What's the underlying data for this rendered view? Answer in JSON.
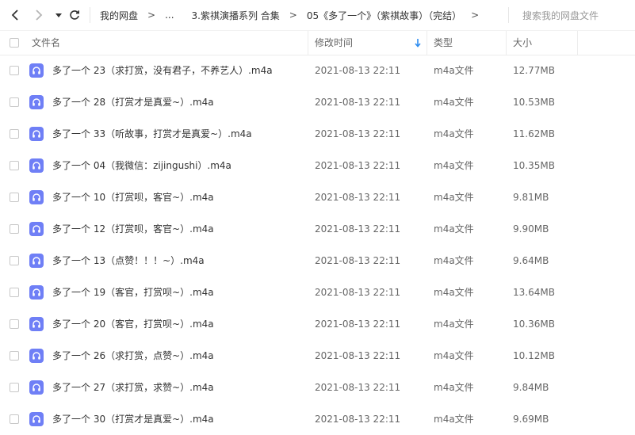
{
  "nav": {
    "breadcrumbs": [
      "我的网盘",
      "...",
      "3.紫祺演播系列 合集",
      "05《多了一个》（紫祺故事）（完结）"
    ],
    "separator": ">",
    "search_placeholder": "搜索我的网盘文件"
  },
  "columns": {
    "name": "文件名",
    "modified": "修改时间",
    "type": "类型",
    "size": "大小"
  },
  "colors": {
    "accent": "#2d8cf0",
    "file_icon": "#6f7ff6"
  },
  "files": [
    {
      "name": "多了一个 23（求打赏，没有君子，不养艺人）.m4a",
      "modified": "2021-08-13 22:11",
      "type": "m4a文件",
      "size": "12.77MB"
    },
    {
      "name": "多了一个 28（打赏才是真爱~）.m4a",
      "modified": "2021-08-13 22:11",
      "type": "m4a文件",
      "size": "10.53MB"
    },
    {
      "name": "多了一个 33（听故事，打赏才是真爱~）.m4a",
      "modified": "2021-08-13 22:11",
      "type": "m4a文件",
      "size": "11.62MB"
    },
    {
      "name": "多了一个 04（我微信：zijingushi）.m4a",
      "modified": "2021-08-13 22:11",
      "type": "m4a文件",
      "size": "10.35MB"
    },
    {
      "name": "多了一个 10（打赏呗，客官~）.m4a",
      "modified": "2021-08-13 22:11",
      "type": "m4a文件",
      "size": "9.81MB"
    },
    {
      "name": "多了一个 12（打赏呗，客官~）.m4a",
      "modified": "2021-08-13 22:11",
      "type": "m4a文件",
      "size": "9.90MB"
    },
    {
      "name": "多了一个 13（点赞！！！~）.m4a",
      "modified": "2021-08-13 22:11",
      "type": "m4a文件",
      "size": "9.64MB"
    },
    {
      "name": "多了一个 19（客官，打赏呗~）.m4a",
      "modified": "2021-08-13 22:11",
      "type": "m4a文件",
      "size": "13.64MB"
    },
    {
      "name": "多了一个 20（客官，打赏呗~）.m4a",
      "modified": "2021-08-13 22:11",
      "type": "m4a文件",
      "size": "10.36MB"
    },
    {
      "name": "多了一个 26（求打赏，点赞~）.m4a",
      "modified": "2021-08-13 22:11",
      "type": "m4a文件",
      "size": "10.12MB"
    },
    {
      "name": "多了一个 27（求打赏，求赞~）.m4a",
      "modified": "2021-08-13 22:11",
      "type": "m4a文件",
      "size": "9.84MB"
    },
    {
      "name": "多了一个 30（打赏才是真爱~）.m4a",
      "modified": "2021-08-13 22:11",
      "type": "m4a文件",
      "size": "9.69MB"
    }
  ]
}
